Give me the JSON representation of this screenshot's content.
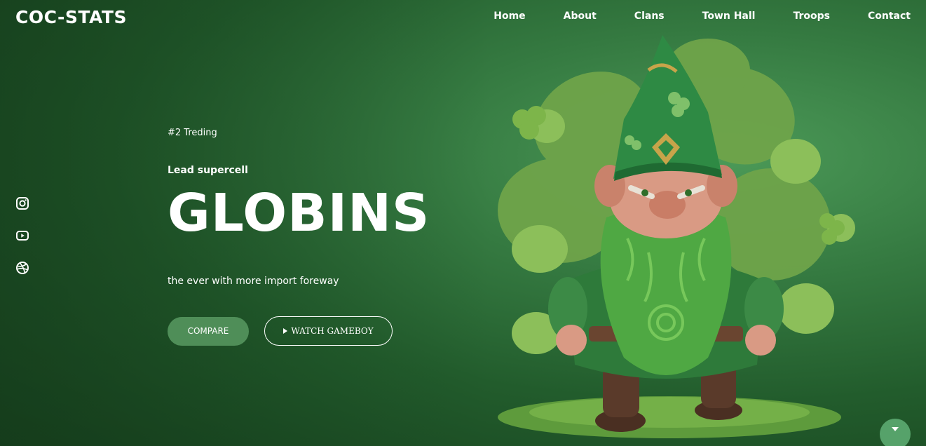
{
  "brand": {
    "logo": "COC-STATS"
  },
  "nav": {
    "items": [
      "Home",
      "About",
      "Clans",
      "Town Hall",
      "Troops",
      "Contact"
    ]
  },
  "socials": [
    "instagram-icon",
    "youtube-icon",
    "dribbble-icon"
  ],
  "hero": {
    "trend": "#2 Treding",
    "lead": "Lead supercell",
    "headline": "GLOBINS",
    "tagline": "the ever with more import foreway",
    "compare_label": "COMPARE",
    "watch_label": "WATCH GAMEBOY"
  },
  "colors": {
    "bg_dark": "#163f1d",
    "bg_light": "#4c9a58",
    "button_green": "#4f8e58",
    "scroll_button": "#56a26a"
  }
}
